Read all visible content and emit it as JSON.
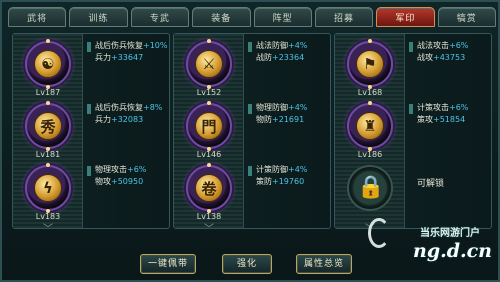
{
  "tabs": [
    {
      "label": "武将"
    },
    {
      "label": "训练"
    },
    {
      "label": "专武"
    },
    {
      "label": "装备"
    },
    {
      "label": "阵型"
    },
    {
      "label": "招募"
    },
    {
      "label": "军印",
      "active": true
    },
    {
      "label": "犒赏"
    }
  ],
  "columns": [
    {
      "slots": [
        {
          "icon": "shield-sword-icon",
          "glyph": "☯",
          "level": "Lv187",
          "attr1": "战后伤兵恢复",
          "attr1_plus": "+10%",
          "attr2": "兵力",
          "attr2_plus": "+33647"
        },
        {
          "icon": "kanji-seal-icon",
          "glyph": "秀",
          "level": "Lv181",
          "attr1": "战后伤兵恢复",
          "attr1_plus": "+8%",
          "attr2": "兵力",
          "attr2_plus": "+32083"
        },
        {
          "icon": "lightning-icon",
          "glyph": "ϟ",
          "level": "Lv183",
          "attr1": "物理攻击",
          "attr1_plus": "+6%",
          "attr2": "物攻",
          "attr2_plus": "+50950"
        }
      ]
    },
    {
      "slots": [
        {
          "icon": "crossed-swords-icon",
          "glyph": "⚔",
          "level": "Lv152",
          "attr1": "战法防御",
          "attr1_plus": "+4%",
          "attr2": "战防",
          "attr2_plus": "+23364"
        },
        {
          "icon": "gate-icon",
          "glyph": "門",
          "level": "Lv146",
          "attr1": "物理防御",
          "attr1_plus": "+4%",
          "attr2": "物防",
          "attr2_plus": "+21691"
        },
        {
          "icon": "scroll-icon",
          "glyph": "卷",
          "level": "Lv138",
          "attr1": "计策防御",
          "attr1_plus": "+4%",
          "attr2": "策防",
          "attr2_plus": "+19760"
        }
      ]
    },
    {
      "slots": [
        {
          "icon": "spear-flag-icon",
          "glyph": "⚑",
          "level": "Lv168",
          "attr1": "战法攻击",
          "attr1_plus": "+6%",
          "attr2": "战攻",
          "attr2_plus": "+43753"
        },
        {
          "icon": "goblet-icon",
          "glyph": "♜",
          "level": "Lv186",
          "attr1": "计策攻击",
          "attr1_plus": "+6%",
          "attr2": "策攻",
          "attr2_plus": "+51854"
        },
        {
          "locked": true,
          "icon": "lock-icon",
          "glyph": "🔒",
          "label": "可解锁"
        }
      ]
    }
  ],
  "buttons": {
    "one_click": "一键佩带",
    "upgrade": "强化",
    "summary": "属性总览"
  },
  "watermark": {
    "text1": "当乐网游门户",
    "text2": "ng.d.cn"
  }
}
